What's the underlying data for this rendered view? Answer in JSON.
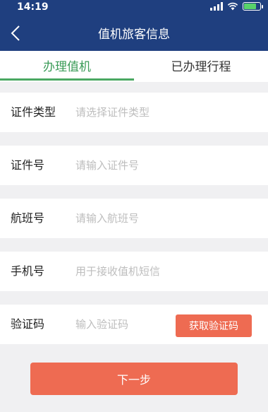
{
  "status_bar": {
    "time": "14:19",
    "icons": [
      "signal-icon",
      "wifi-icon",
      "battery-charging-icon"
    ]
  },
  "navbar": {
    "title": "值机旅客信息",
    "back_icon": "chevron-left-icon"
  },
  "tabs": [
    {
      "label": "办理值机",
      "active": true
    },
    {
      "label": "已办理行程",
      "active": false
    }
  ],
  "form": {
    "fields": [
      {
        "label": "证件类型",
        "placeholder": "请选择证件类型",
        "value": ""
      },
      {
        "label": "证件号",
        "placeholder": "请输入证件号",
        "value": ""
      },
      {
        "label": "航班号",
        "placeholder": "请输入航班号",
        "value": ""
      },
      {
        "label": "手机号",
        "placeholder": "用于接收值机短信",
        "value": ""
      },
      {
        "label": "验证码",
        "placeholder": "输入验证码",
        "value": ""
      }
    ],
    "get_code_label": "获取验证码",
    "next_label": "下一步"
  },
  "colors": {
    "header": "#1f3f7f",
    "tab_active": "#3a9b57",
    "button": "#ee6b52",
    "background": "#f0f0f2"
  }
}
